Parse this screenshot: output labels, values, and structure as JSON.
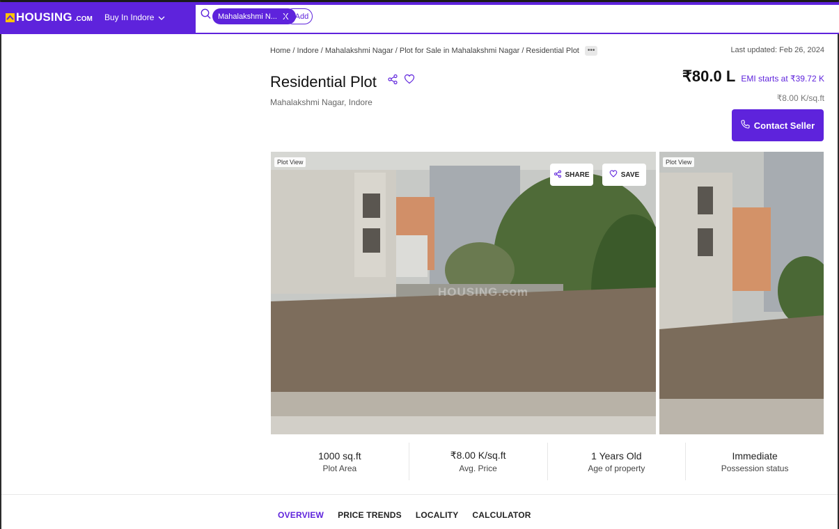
{
  "header": {
    "logo_text": "HOUSING",
    "logo_suffix": ".COM",
    "buy_in": "Buy In Indore",
    "search_chip": "Mahalakshmi N...",
    "chip_close": "X",
    "add_label": "+ Add"
  },
  "breadcrumb": {
    "path": "Home / Indore / Mahalakshmi Nagar / Plot for Sale in Mahalakshmi Nagar / Residential Plot",
    "more": "•••"
  },
  "last_updated": "Last updated: Feb 26, 2024",
  "property": {
    "title": "Residential Plot",
    "locality": "Mahalakshmi Nagar, Indore",
    "price": "₹80.0 L",
    "emi": "EMI starts at ₹39.72 K",
    "price_per_sqft": "₹8.00 K/sq.ft",
    "contact_label": "Contact Seller"
  },
  "gallery": {
    "main_tag": "Plot View",
    "side_tag": "Plot View",
    "share_label": "SHARE",
    "save_label": "SAVE",
    "watermark": "HOUSING.com"
  },
  "stats": [
    {
      "value": "1000 sq.ft",
      "label": "Plot Area"
    },
    {
      "value": "₹8.00 K/sq.ft",
      "label": "Avg. Price"
    },
    {
      "value": "1 Years Old",
      "label": "Age of property"
    },
    {
      "value": "Immediate",
      "label": "Possession status"
    }
  ],
  "tabs": [
    {
      "label": "OVERVIEW",
      "active": true
    },
    {
      "label": "PRICE TRENDS",
      "active": false
    },
    {
      "label": "LOCALITY",
      "active": false
    },
    {
      "label": "CALCULATOR",
      "active": false
    }
  ],
  "colors": {
    "brand": "#5e23dc",
    "logo_accent": "#ffc400"
  },
  "icons": [
    "house-logo-icon",
    "chevron-down-icon",
    "search-icon",
    "share-icon",
    "heart-icon",
    "phone-icon"
  ]
}
